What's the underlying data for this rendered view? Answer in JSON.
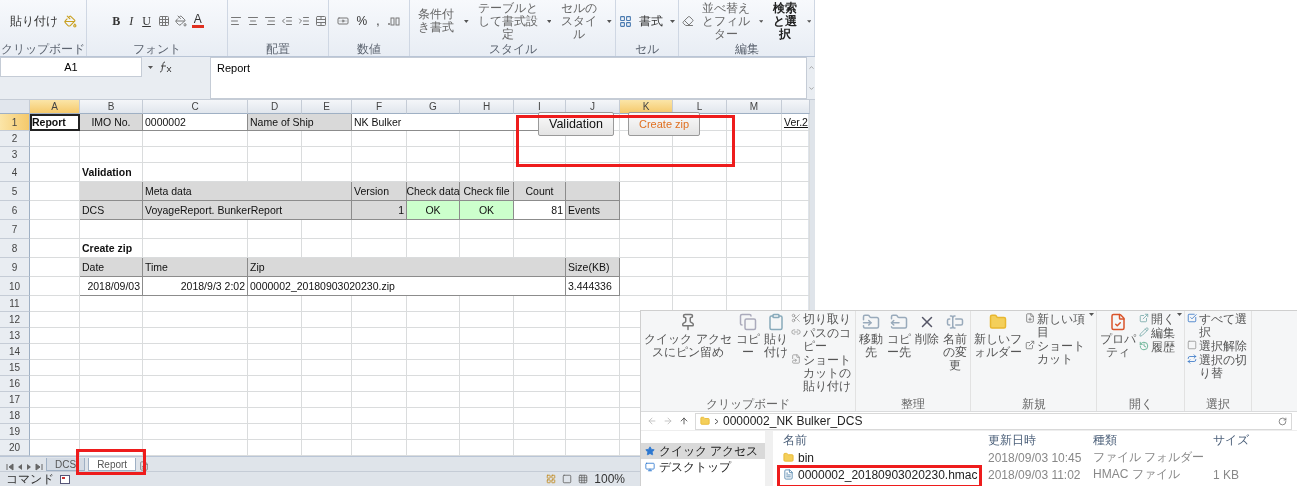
{
  "excel": {
    "ribbon": [
      {
        "kind": "clipboard",
        "label": "クリップボード",
        "items": [
          "貼り付け"
        ]
      },
      {
        "kind": "font",
        "label": "フォント",
        "items": [
          "B",
          "I",
          "U",
          "A"
        ]
      },
      {
        "kind": "alignment",
        "label": "配置"
      },
      {
        "kind": "number",
        "label": "数値",
        "items": [
          "%",
          ","
        ]
      },
      {
        "kind": "styles",
        "label": "スタイル",
        "items": [
          "条件付き書式",
          "テーブルとして書式設定",
          "セルのスタイル"
        ]
      },
      {
        "kind": "cells",
        "label": "セル",
        "items": [
          "書式"
        ]
      },
      {
        "kind": "editing",
        "label": "編集",
        "items": [
          "並べ替えとフィルター",
          "検索と選択"
        ]
      }
    ],
    "name_box": "A1",
    "formula": "Report",
    "columns": [
      {
        "label": "A",
        "selected": true
      },
      {
        "label": "B",
        "selected": false
      },
      {
        "label": "C",
        "selected": false
      },
      {
        "label": "D",
        "selected": false
      },
      {
        "label": "E",
        "selected": false
      },
      {
        "label": "F",
        "selected": false
      },
      {
        "label": "G",
        "selected": false
      },
      {
        "label": "H",
        "selected": false
      },
      {
        "label": "I",
        "selected": false
      },
      {
        "label": "J",
        "selected": false
      },
      {
        "label": "K",
        "selected": true
      },
      {
        "label": "L",
        "selected": false
      },
      {
        "label": "M",
        "selected": false
      }
    ],
    "rows": [
      {
        "number": "1",
        "selected": true,
        "cells": [
          {
            "kind": "active",
            "text": "Report"
          },
          {
            "kind": "label_center",
            "text": "IMO No."
          },
          {
            "kind": "value",
            "text": "0000002"
          },
          {
            "kind": "label",
            "text": "Name of Ship"
          },
          {
            "kind": "merged"
          },
          {
            "kind": "value",
            "text": "NK Bulker"
          },
          {
            "kind": "merged"
          },
          {
            "kind": "merged"
          },
          {
            "kind": "merged"
          },
          {
            "kind": "blank"
          },
          {
            "kind": "blank"
          },
          {
            "kind": "blank"
          },
          {
            "kind": "blank"
          },
          {
            "kind": "link",
            "text": "Ver.2"
          }
        ]
      },
      {
        "number": "2",
        "selected": false
      },
      {
        "number": "3",
        "selected": false
      },
      {
        "number": "4",
        "selected": false,
        "cells": [
          {
            "kind": "blank"
          },
          {
            "kind": "title",
            "text": "Validation"
          }
        ]
      },
      {
        "number": "5",
        "selected": false,
        "cells": [
          {
            "kind": "blank"
          },
          {
            "kind": "label"
          },
          {
            "kind": "label",
            "text": "Meta data"
          },
          {
            "kind": "merged"
          },
          {
            "kind": "merged"
          },
          {
            "kind": "label",
            "text": "Version"
          },
          {
            "kind": "label_center",
            "text": "Check data"
          },
          {
            "kind": "label_center",
            "text": "Check file"
          },
          {
            "kind": "label_center",
            "text": "Count"
          },
          {
            "kind": "label"
          }
        ]
      },
      {
        "number": "6",
        "selected": false,
        "cells": [
          {
            "kind": "blank"
          },
          {
            "kind": "label",
            "text": "DCS"
          },
          {
            "kind": "label",
            "text": "VoyageReport. BunkerReport"
          },
          {
            "kind": "merged"
          },
          {
            "kind": "merged"
          },
          {
            "kind": "label_num",
            "text": "1"
          },
          {
            "kind": "ok",
            "text": "OK"
          },
          {
            "kind": "ok",
            "text": "OK"
          },
          {
            "kind": "value_num",
            "text": "81"
          },
          {
            "kind": "label",
            "text": "Events"
          }
        ]
      },
      {
        "number": "7",
        "selected": false
      },
      {
        "number": "8",
        "selected": false,
        "cells": [
          {
            "kind": "blank"
          },
          {
            "kind": "title",
            "text": "Create zip"
          }
        ]
      },
      {
        "number": "9",
        "selected": false,
        "cells": [
          {
            "kind": "blank"
          },
          {
            "kind": "label",
            "text": "Date"
          },
          {
            "kind": "label",
            "text": "Time"
          },
          {
            "kind": "label",
            "text": "Zip"
          },
          {
            "kind": "merged"
          },
          {
            "kind": "merged"
          },
          {
            "kind": "merged"
          },
          {
            "kind": "merged"
          },
          {
            "kind": "merged"
          },
          {
            "kind": "label",
            "text": "Size(KB)"
          }
        ]
      },
      {
        "number": "10",
        "selected": false,
        "cells": [
          {
            "kind": "blank"
          },
          {
            "kind": "value_num",
            "text": "2018/09/03"
          },
          {
            "kind": "value_num",
            "text": "2018/9/3 2:02"
          },
          {
            "kind": "value",
            "text": "0000002_20180903020230.zip"
          },
          {
            "kind": "merged"
          },
          {
            "kind": "merged"
          },
          {
            "kind": "merged"
          },
          {
            "kind": "merged"
          },
          {
            "kind": "merged"
          },
          {
            "kind": "value",
            "text": "3.444336"
          }
        ]
      },
      {
        "number": "11",
        "selected": false
      },
      {
        "number": "12",
        "selected": false
      },
      {
        "number": "13",
        "selected": false
      },
      {
        "number": "14",
        "selected": false
      },
      {
        "number": "15",
        "selected": false
      },
      {
        "number": "16",
        "selected": false
      },
      {
        "number": "17",
        "selected": false
      },
      {
        "number": "18",
        "selected": false
      },
      {
        "number": "19",
        "selected": false
      },
      {
        "number": "20",
        "selected": false
      }
    ],
    "buttons": [
      {
        "label": "Validation",
        "kind": "plain"
      },
      {
        "label": "Create zip",
        "kind": "accent"
      }
    ],
    "sheet_tabs": [
      {
        "label": "DCS",
        "selected": false
      },
      {
        "label": "Report",
        "selected": true
      }
    ],
    "status_bar": {
      "mode": "コマンド",
      "zoom": "100%"
    }
  },
  "explorer": {
    "ribbon": [
      {
        "kind": "clipboard",
        "label": "クリップボード",
        "large": [
          "クイック アクセスにピン留め",
          "コピー",
          "貼り付け"
        ],
        "small": [
          "切り取り",
          "パスのコピー",
          "ショートカットの貼り付け"
        ]
      },
      {
        "kind": "organize",
        "label": "整理",
        "large": [
          "移動先",
          "コピー先",
          "削除",
          "名前の変更"
        ]
      },
      {
        "kind": "new",
        "label": "新規",
        "large": [
          "新しいフォルダー"
        ],
        "small": [
          "新しい項目",
          "ショートカット"
        ]
      },
      {
        "kind": "open",
        "label": "開く",
        "large": [
          "プロパティ"
        ],
        "small": [
          "開く",
          "編集",
          "履歴"
        ]
      },
      {
        "kind": "select",
        "label": "選択",
        "small": [
          "すべて選択",
          "選択解除",
          "選択の切り替"
        ]
      }
    ],
    "address": "0000002_NK Bulker_DCS",
    "nav": [
      {
        "label": "クイック アクセス",
        "selected": true
      },
      {
        "label": "デスクトップ",
        "selected": false
      }
    ],
    "columns": [
      "名前",
      "更新日時",
      "種類",
      "サイズ"
    ],
    "files": [
      {
        "kind": "folder",
        "name": "bin",
        "modified": "2018/09/03 10:45",
        "type": "ファイル フォルダー"
      },
      {
        "kind": "file",
        "name": "0000002_20180903020230.hmac",
        "modified": "2018/09/03 11:02",
        "type": "HMAC ファイル",
        "size": "1 KB"
      }
    ]
  }
}
